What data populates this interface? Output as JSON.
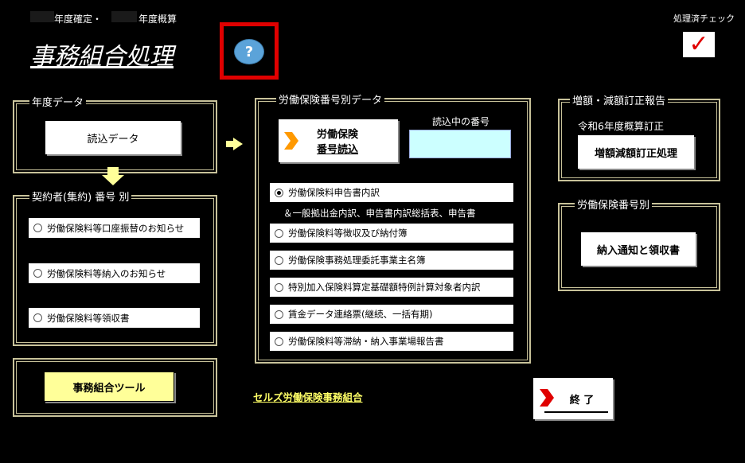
{
  "header": {
    "fiscal_confirm_label": "年度確定・",
    "fiscal_estimate_label": "年度概算",
    "app_title": "事務組合処理",
    "help_symbol": "?",
    "processed_check_label": "処理済チェック",
    "check_mark": "✓"
  },
  "fiscal_data": {
    "legend": "年度データ",
    "load_button": "読込データ"
  },
  "contractor": {
    "legend": "契約者(集約) 番号 別",
    "options": [
      "労働保険料等口座振替のお知らせ",
      "労働保険料等納入のお知らせ",
      "労働保険料等領収書"
    ]
  },
  "tools": {
    "tool_button": "事務組合ツール"
  },
  "insurance_number_data": {
    "legend": "労働保険番号別データ",
    "load_button_line1": "労働保険",
    "load_button_line2": "番号読込",
    "current_number_label": "読込中の番号",
    "current_number_value": "",
    "options": [
      "労働保険料申告書内訳",
      "労働保険料等徴収及び納付簿",
      "労働保険事務処理委託事業主名簿",
      "特別加入保険料算定基礎額特例計算対象者内訳",
      "賃金データ連絡票(継続、一括有期)",
      "労働保険料等滞納・納入事業場報告書"
    ],
    "option_note": "＆一般拠出金内訳、申告書内訳総括表、申告書",
    "selected_index": 0
  },
  "correction": {
    "legend": "増額・減額訂正報告",
    "subtitle": "令和6年度概算訂正",
    "button": "増額減額訂正処理"
  },
  "insurance_number": {
    "legend": "労働保険番号別",
    "button": "納入通知と領収書"
  },
  "footer": {
    "org_link": "セルズ労働保険事務組合",
    "exit_button": "終 了"
  },
  "colors": {
    "frame": "#c8c29a",
    "arrow": "#ffff99",
    "help_circle": "#5ba3d9",
    "help_border": "#e00000",
    "check": "#e00000",
    "number_box": "#ccffff",
    "tool_button_bg": "#ffff99",
    "chevron_orange": "#ff9900",
    "chevron_red": "#e00000"
  }
}
